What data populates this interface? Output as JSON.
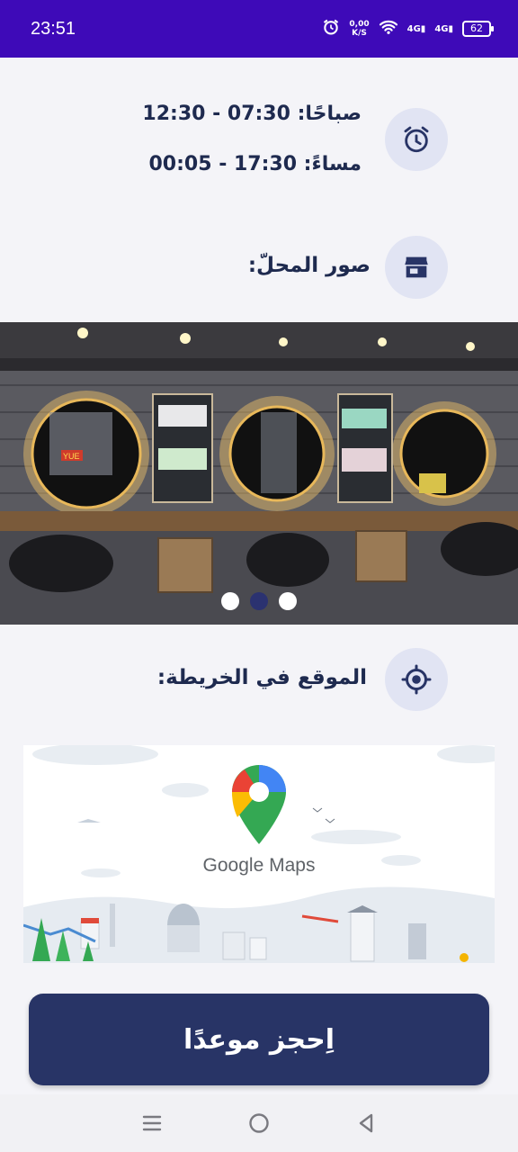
{
  "status_bar": {
    "time": "23:51",
    "speed_value": "0,00",
    "speed_unit": "K/S",
    "net1": "4G",
    "net2": "4G",
    "battery": "62"
  },
  "hours": {
    "morning": "صباحًا: 07:30 - 12:30",
    "evening": "مساءً: 17:30 - 00:05",
    "icon": "alarm-clock-icon"
  },
  "shop_photos": {
    "title": "صور المحلّ:",
    "icon": "store-icon",
    "slides_count": 3,
    "active_slide": 2,
    "photo_sign_text": "YUE"
  },
  "map_section": {
    "title": "الموقع في الخريطة:",
    "icon": "location-target-icon",
    "map_label": "Google Maps"
  },
  "book_button": {
    "label": "اِحجز موعدًا"
  },
  "colors": {
    "status_bar": "#3e0ab8",
    "accent": "#283466",
    "icon_bg": "#e1e4f3",
    "page_bg": "#f4f4f8"
  }
}
